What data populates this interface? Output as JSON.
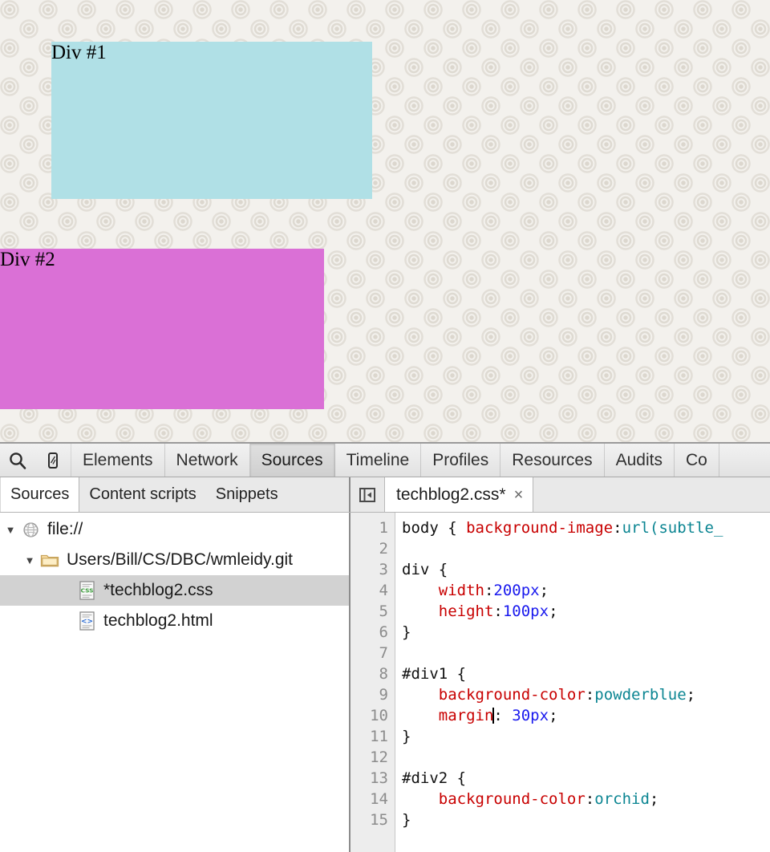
{
  "page": {
    "div1": {
      "label": "Div #1",
      "background_color": "#b0e0e6"
    },
    "div2": {
      "label": "Div #2",
      "background_color": "#da70d6"
    }
  },
  "devtools": {
    "toolbar": {
      "inspect_icon": "magnifier-icon",
      "device_icon": "mobile-device-icon",
      "tabs": [
        {
          "label": "Elements",
          "active": false
        },
        {
          "label": "Network",
          "active": false
        },
        {
          "label": "Sources",
          "active": true
        },
        {
          "label": "Timeline",
          "active": false
        },
        {
          "label": "Profiles",
          "active": false
        },
        {
          "label": "Resources",
          "active": false
        },
        {
          "label": "Audits",
          "active": false
        },
        {
          "label": "Co",
          "active": false
        }
      ]
    },
    "sub_tabs": [
      {
        "label": "Sources",
        "active": true
      },
      {
        "label": "Content scripts",
        "active": false
      },
      {
        "label": "Snippets",
        "active": false
      }
    ],
    "collapse_icon": "panel-collapse-icon",
    "file_tab": {
      "name": "techblog2.css*",
      "close_label": "×"
    },
    "navigator": {
      "rows": [
        {
          "twisty": "▼",
          "icon": "globe-icon",
          "label": "file://",
          "indent": 1,
          "selected": false
        },
        {
          "twisty": "▼",
          "icon": "folder-icon",
          "label": "Users/Bill/CS/DBC/wmleidy.git",
          "indent": 2,
          "selected": false
        },
        {
          "twisty": "",
          "icon": "css-file-icon",
          "label": "*techblog2.css",
          "indent": 3,
          "selected": true
        },
        {
          "twisty": "",
          "icon": "html-file-icon",
          "label": "techblog2.html",
          "indent": 3,
          "selected": false
        }
      ]
    },
    "editor": {
      "line_numbers": [
        "1",
        "2",
        "3",
        "4",
        "5",
        "6",
        "7",
        "8",
        "9",
        "10",
        "11",
        "12",
        "13",
        "14",
        "15"
      ],
      "lines": [
        [
          {
            "t": "body { ",
            "c": "plain"
          },
          {
            "t": "background-image",
            "c": "prop"
          },
          {
            "t": ":",
            "c": "plain"
          },
          {
            "t": "url(subtle_",
            "c": "val"
          }
        ],
        [],
        [
          {
            "t": "div {",
            "c": "plain"
          }
        ],
        [
          {
            "t": "    ",
            "c": "plain"
          },
          {
            "t": "width",
            "c": "prop"
          },
          {
            "t": ":",
            "c": "plain"
          },
          {
            "t": "200px",
            "c": "num"
          },
          {
            "t": ";",
            "c": "plain"
          }
        ],
        [
          {
            "t": "    ",
            "c": "plain"
          },
          {
            "t": "height",
            "c": "prop"
          },
          {
            "t": ":",
            "c": "plain"
          },
          {
            "t": "100px",
            "c": "num"
          },
          {
            "t": ";",
            "c": "plain"
          }
        ],
        [
          {
            "t": "}",
            "c": "plain"
          }
        ],
        [],
        [
          {
            "t": "#div1 {",
            "c": "plain"
          }
        ],
        [
          {
            "t": "    ",
            "c": "plain"
          },
          {
            "t": "background-color",
            "c": "prop"
          },
          {
            "t": ":",
            "c": "plain"
          },
          {
            "t": "powderblue",
            "c": "val"
          },
          {
            "t": ";",
            "c": "plain"
          }
        ],
        [
          {
            "t": "    ",
            "c": "plain"
          },
          {
            "t": "margin",
            "c": "prop"
          },
          {
            "t": "",
            "c": "caret"
          },
          {
            "t": ": ",
            "c": "plain"
          },
          {
            "t": "30px",
            "c": "num"
          },
          {
            "t": ";",
            "c": "plain"
          }
        ],
        [
          {
            "t": "}",
            "c": "plain"
          }
        ],
        [],
        [
          {
            "t": "#div2 {",
            "c": "plain"
          }
        ],
        [
          {
            "t": "    ",
            "c": "plain"
          },
          {
            "t": "background-color",
            "c": "prop"
          },
          {
            "t": ":",
            "c": "plain"
          },
          {
            "t": "orchid",
            "c": "val"
          },
          {
            "t": ";",
            "c": "plain"
          }
        ],
        [
          {
            "t": "}",
            "c": "plain"
          }
        ]
      ]
    }
  }
}
